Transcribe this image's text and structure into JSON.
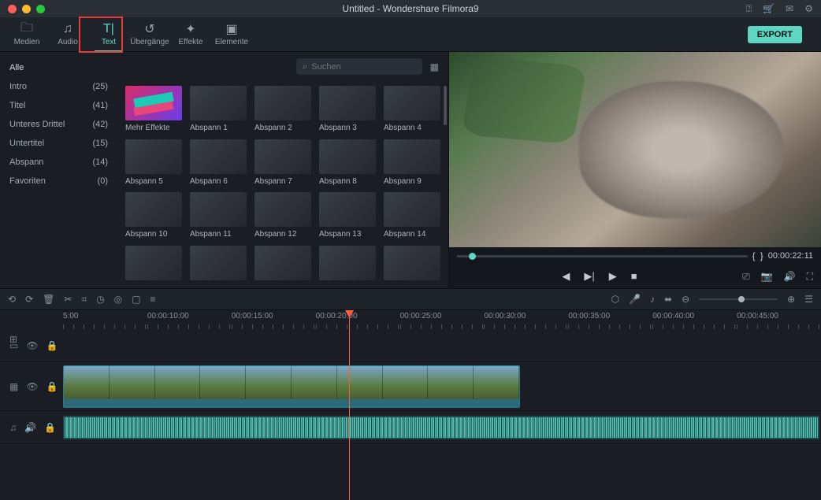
{
  "window": {
    "title": "Untitled - Wondershare Filmora9"
  },
  "topnav": {
    "items": [
      {
        "label": "Medien",
        "icon": "folder"
      },
      {
        "label": "Audio",
        "icon": "music"
      },
      {
        "label": "Text",
        "icon": "text",
        "active": true
      },
      {
        "label": "Übergänge",
        "icon": "transition"
      },
      {
        "label": "Effekte",
        "icon": "sparkle"
      },
      {
        "label": "Elemente",
        "icon": "image"
      }
    ],
    "export": "EXPORT"
  },
  "categories": [
    {
      "name": "Alle",
      "count": ""
    },
    {
      "name": "Intro",
      "count": "(25)"
    },
    {
      "name": "Titel",
      "count": "(41)"
    },
    {
      "name": "Unteres Drittel",
      "count": "(42)"
    },
    {
      "name": "Untertitel",
      "count": "(15)"
    },
    {
      "name": "Abspann",
      "count": "(14)"
    },
    {
      "name": "Favoriten",
      "count": "(0)"
    }
  ],
  "search": {
    "placeholder": "Suchen"
  },
  "thumbs": [
    {
      "label": "Mehr Effekte",
      "store": true
    },
    {
      "label": "Abspann 1"
    },
    {
      "label": "Abspann 2"
    },
    {
      "label": "Abspann 3"
    },
    {
      "label": "Abspann 4"
    },
    {
      "label": "Abspann 5"
    },
    {
      "label": "Abspann 6"
    },
    {
      "label": "Abspann 7"
    },
    {
      "label": "Abspann 8"
    },
    {
      "label": "Abspann 9"
    },
    {
      "label": "Abspann 10"
    },
    {
      "label": "Abspann 11"
    },
    {
      "label": "Abspann 12"
    },
    {
      "label": "Abspann 13"
    },
    {
      "label": "Abspann 14"
    },
    {
      "label": ""
    },
    {
      "label": ""
    },
    {
      "label": ""
    },
    {
      "label": ""
    },
    {
      "label": ""
    }
  ],
  "preview": {
    "timecode": "00:00:22:11",
    "braces_l": "{",
    "braces_r": "}"
  },
  "ruler": [
    "5:00",
    "00:00:10:00",
    "00:00:15:00",
    "00:00:20:00",
    "00:00:25:00",
    "00:00:30:00",
    "00:00:35:00",
    "00:00:40:00",
    "00:00:45:00"
  ]
}
